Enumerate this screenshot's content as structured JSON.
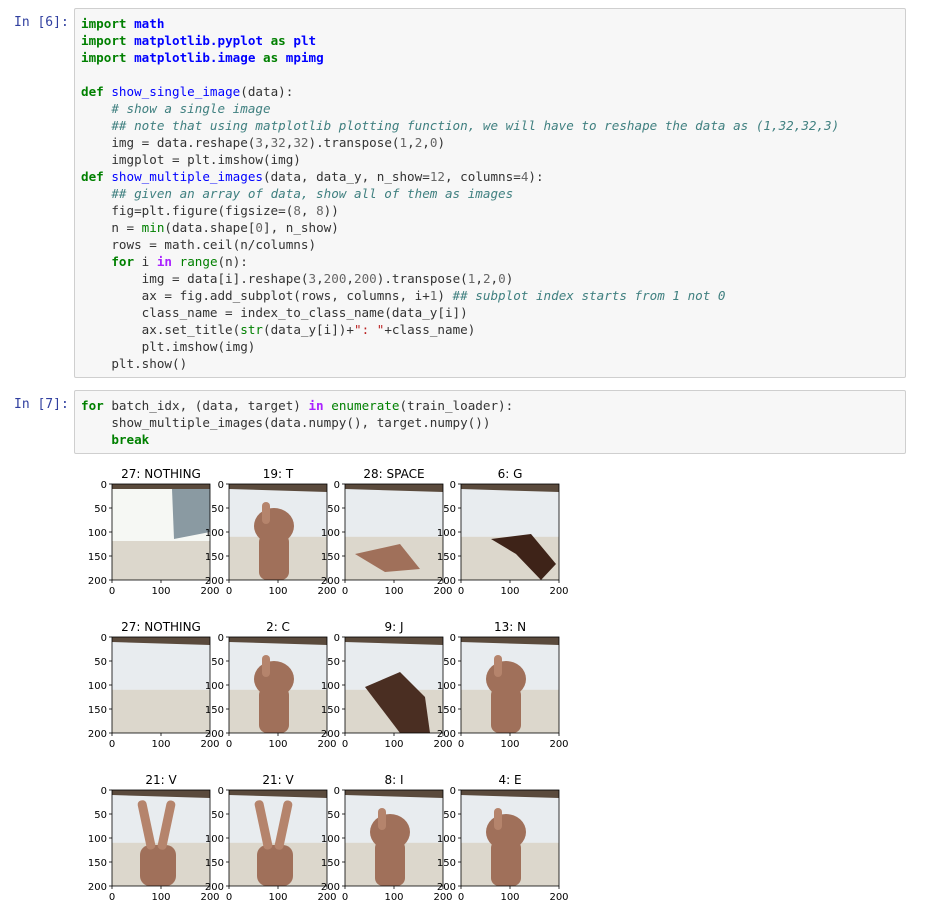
{
  "cells": [
    {
      "prompt": "In [6]:",
      "lines": [
        [
          [
            "kw",
            "import"
          ],
          [
            "t",
            " "
          ],
          [
            "mod",
            "math"
          ]
        ],
        [
          [
            "kw",
            "import"
          ],
          [
            "t",
            " "
          ],
          [
            "mod",
            "matplotlib.pyplot"
          ],
          [
            "t",
            " "
          ],
          [
            "kw",
            "as"
          ],
          [
            "t",
            " "
          ],
          [
            "mod",
            "plt"
          ]
        ],
        [
          [
            "kw",
            "import"
          ],
          [
            "t",
            " "
          ],
          [
            "mod",
            "matplotlib.image"
          ],
          [
            "t",
            " "
          ],
          [
            "kw",
            "as"
          ],
          [
            "t",
            " "
          ],
          [
            "mod",
            "mpimg"
          ]
        ],
        [
          [
            "t",
            ""
          ]
        ],
        [
          [
            "kw",
            "def"
          ],
          [
            "t",
            " "
          ],
          [
            "fn",
            "show_single_image"
          ],
          [
            "t",
            "(data):"
          ]
        ],
        [
          [
            "t",
            "    "
          ],
          [
            "cm",
            "# show a single image"
          ]
        ],
        [
          [
            "t",
            "    "
          ],
          [
            "cm",
            "## note that using matplotlib plotting function, we will have to reshape the data as (1,32,32,3)"
          ]
        ],
        [
          [
            "t",
            "    img = data.reshape("
          ],
          [
            "nu",
            "3"
          ],
          [
            "t",
            ","
          ],
          [
            "nu",
            "32"
          ],
          [
            "t",
            ","
          ],
          [
            "nu",
            "32"
          ],
          [
            "t",
            ").transpose("
          ],
          [
            "nu",
            "1"
          ],
          [
            "t",
            ","
          ],
          [
            "nu",
            "2"
          ],
          [
            "t",
            ","
          ],
          [
            "nu",
            "0"
          ],
          [
            "t",
            ")"
          ]
        ],
        [
          [
            "t",
            "    imgplot = plt.imshow(img)"
          ]
        ],
        [
          [
            "kw",
            "def"
          ],
          [
            "t",
            " "
          ],
          [
            "fn",
            "show_multiple_images"
          ],
          [
            "t",
            "(data, data_y, n_show="
          ],
          [
            "nu",
            "12"
          ],
          [
            "t",
            ", columns="
          ],
          [
            "nu",
            "4"
          ],
          [
            "t",
            "):"
          ]
        ],
        [
          [
            "t",
            "    "
          ],
          [
            "cm",
            "## given an array of data, show all of them as images"
          ]
        ],
        [
          [
            "t",
            "    fig=plt.figure(figsize=("
          ],
          [
            "nu",
            "8"
          ],
          [
            "t",
            ", "
          ],
          [
            "nu",
            "8"
          ],
          [
            "t",
            "))"
          ]
        ],
        [
          [
            "t",
            "    n = "
          ],
          [
            "bi",
            "min"
          ],
          [
            "t",
            "(data.shape["
          ],
          [
            "nu",
            "0"
          ],
          [
            "t",
            "], n_show)"
          ]
        ],
        [
          [
            "t",
            "    rows = math.ceil(n/columns)"
          ]
        ],
        [
          [
            "t",
            "    "
          ],
          [
            "kw",
            "for"
          ],
          [
            "t",
            " i "
          ],
          [
            "op",
            "in"
          ],
          [
            "t",
            " "
          ],
          [
            "bi",
            "range"
          ],
          [
            "t",
            "(n):"
          ]
        ],
        [
          [
            "t",
            "        img = data[i].reshape("
          ],
          [
            "nu",
            "3"
          ],
          [
            "t",
            ","
          ],
          [
            "nu",
            "200"
          ],
          [
            "t",
            ","
          ],
          [
            "nu",
            "200"
          ],
          [
            "t",
            ").transpose("
          ],
          [
            "nu",
            "1"
          ],
          [
            "t",
            ","
          ],
          [
            "nu",
            "2"
          ],
          [
            "t",
            ","
          ],
          [
            "nu",
            "0"
          ],
          [
            "t",
            ")"
          ]
        ],
        [
          [
            "t",
            "        ax = fig.add_subplot(rows, columns, i+"
          ],
          [
            "nu",
            "1"
          ],
          [
            "t",
            ") "
          ],
          [
            "cm",
            "## subplot index starts from 1 not 0"
          ]
        ],
        [
          [
            "t",
            "        class_name = index_to_class_name(data_y[i])"
          ]
        ],
        [
          [
            "t",
            "        ax.set_title("
          ],
          [
            "bi",
            "str"
          ],
          [
            "t",
            "(data_y[i])+"
          ],
          [
            "st",
            "\": \""
          ],
          [
            "t",
            "+class_name)"
          ]
        ],
        [
          [
            "t",
            "        plt.imshow(img)"
          ]
        ],
        [
          [
            "t",
            "    plt.show()"
          ]
        ]
      ]
    },
    {
      "prompt": "In [7]:",
      "lines": [
        [
          [
            "kw",
            "for"
          ],
          [
            "t",
            " batch_idx, (data, target) "
          ],
          [
            "op",
            "in"
          ],
          [
            "t",
            " "
          ],
          [
            "bi",
            "enumerate"
          ],
          [
            "t",
            "(train_loader):"
          ]
        ],
        [
          [
            "t",
            "    show_multiple_images(data.numpy(), target.numpy())"
          ]
        ],
        [
          [
            "t",
            "    "
          ],
          [
            "kw",
            "break"
          ]
        ]
      ]
    }
  ],
  "output": {
    "xticks": [
      "0",
      "100",
      "200"
    ],
    "yticks": [
      "0",
      "50",
      "100",
      "150",
      "200"
    ],
    "subplots": [
      {
        "title": "27: NOTHING",
        "scene": "nothing-light"
      },
      {
        "title": "19: T",
        "scene": "hand"
      },
      {
        "title": "28: SPACE",
        "scene": "space"
      },
      {
        "title": "6: G",
        "scene": "hand-side"
      },
      {
        "title": "27: NOTHING",
        "scene": "nothing"
      },
      {
        "title": "2: C",
        "scene": "hand-c"
      },
      {
        "title": "9: J",
        "scene": "hand-dark"
      },
      {
        "title": "13: N",
        "scene": "fist"
      },
      {
        "title": "21: V",
        "scene": "v"
      },
      {
        "title": "21: V",
        "scene": "v2"
      },
      {
        "title": "8: I",
        "scene": "hand-i"
      },
      {
        "title": "4: E",
        "scene": "hand-e"
      }
    ]
  },
  "colors": {
    "prompt": "#303f9f",
    "wall": "#dcd7cc",
    "skin": "#a0705a",
    "ceiling": "#5a4a3c"
  }
}
